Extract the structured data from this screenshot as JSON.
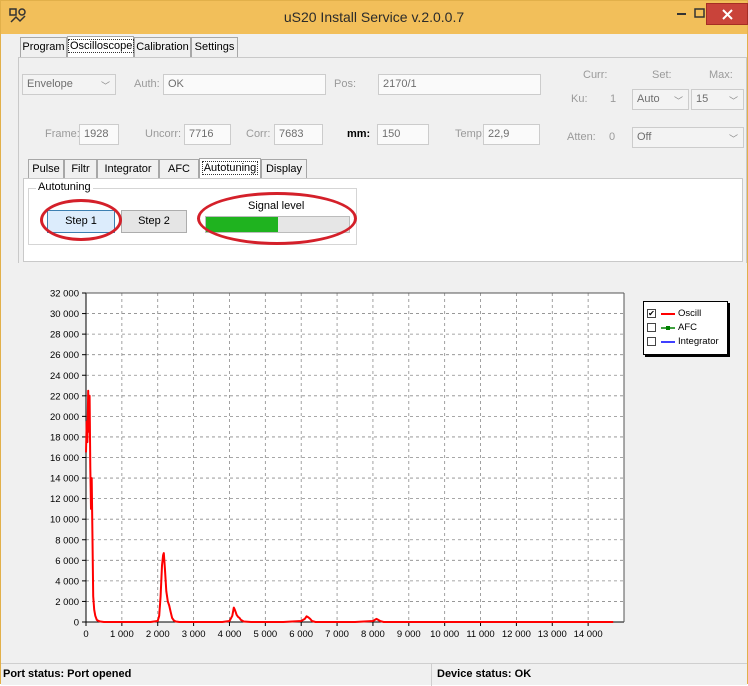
{
  "window": {
    "title": "uS20 Install Service v.2.0.0.7"
  },
  "main_tabs": [
    {
      "label": "Program"
    },
    {
      "label": "Oscilloscope",
      "active": true
    },
    {
      "label": "Calibration"
    },
    {
      "label": "Settings"
    }
  ],
  "params": {
    "mode": "Envelope",
    "auth_label": "Auth:",
    "auth_value": "OK",
    "pos_label": "Pos:",
    "pos_value": "2170/1",
    "frame_label": "Frame:",
    "frame_value": "1928",
    "uncorr_label": "Uncorr:",
    "uncorr_value": "7716",
    "corr_label": "Corr:",
    "corr_value": "7683",
    "mm_label": "mm:",
    "mm_value": "150",
    "temp_label": "Temp:",
    "temp_value": "22,9",
    "curr_header": "Curr:",
    "set_header": "Set:",
    "max_header": "Max:",
    "ku_label": "Ku:",
    "ku_curr": "1",
    "ku_set": "Auto",
    "ku_max": "15",
    "atten_label": "Atten:",
    "atten_curr": "0",
    "atten_set": "Off"
  },
  "sub_tabs": [
    {
      "label": "Pulse"
    },
    {
      "label": "Filtr"
    },
    {
      "label": "Integrator"
    },
    {
      "label": "AFC"
    },
    {
      "label": "Autotuning",
      "active": true
    },
    {
      "label": "Display"
    }
  ],
  "autotuning": {
    "group_label": "Autotuning",
    "step1_label": "Step 1",
    "step2_label": "Step 2",
    "signal_label": "Signal level",
    "signal_level_fraction": 0.5
  },
  "colors": {
    "oscill": "#ff0000",
    "afc": "#008000",
    "integrator": "#0000ff",
    "annotation_ring": "#d4202a",
    "progress": "#1fb31f"
  },
  "legend": [
    {
      "label": "Oscill",
      "checked": true,
      "color": "#ff0000"
    },
    {
      "label": "AFC",
      "checked": false,
      "color": "#008000"
    },
    {
      "label": "Integrator",
      "checked": false,
      "color": "#0000ff"
    }
  ],
  "chart_data": {
    "type": "line",
    "grid": true,
    "legend_position": "top-right",
    "xlim": [
      0,
      15000
    ],
    "ylim": [
      0,
      32000
    ],
    "x_ticks": [
      "0",
      "1 000",
      "2 000",
      "3 000",
      "4 000",
      "5 000",
      "6 000",
      "7 000",
      "8 000",
      "9 000",
      "10 000",
      "11 000",
      "12 000",
      "13 000",
      "14 000"
    ],
    "y_ticks": [
      "0",
      "2 000",
      "4 000",
      "6 000",
      "8 000",
      "10 000",
      "12 000",
      "14 000",
      "16 000",
      "18 000",
      "20 000",
      "22 000",
      "24 000",
      "26 000",
      "28 000",
      "30 000",
      "32 000"
    ],
    "series": [
      {
        "name": "Oscill",
        "x": [
          0,
          20,
          40,
          60,
          80,
          100,
          120,
          140,
          160,
          180,
          200,
          230,
          260,
          300,
          350,
          400,
          500,
          700,
          1000,
          1400,
          1800,
          2000,
          2040,
          2080,
          2120,
          2150,
          2170,
          2200,
          2240,
          2280,
          2320,
          2360,
          2400,
          2450,
          2500,
          2600,
          2800,
          3000,
          3400,
          3800,
          4000,
          4080,
          4120,
          4150,
          4180,
          4200,
          4240,
          4280,
          4320,
          4400,
          4600,
          5000,
          5500,
          6000,
          6100,
          6150,
          6200,
          6250,
          6300,
          6400,
          6600,
          7000,
          7500,
          8000,
          8100,
          8150,
          8200,
          8300,
          8500,
          9000,
          10000,
          11000,
          12000,
          13000,
          14000,
          14700
        ],
        "y": [
          16500,
          19500,
          17500,
          22500,
          18500,
          22000,
          15000,
          11000,
          14000,
          8000,
          2500,
          1200,
          600,
          200,
          100,
          50,
          0,
          0,
          0,
          0,
          0,
          100,
          600,
          2500,
          5500,
          6500,
          6700,
          5200,
          3000,
          2000,
          1600,
          1000,
          400,
          150,
          50,
          0,
          0,
          0,
          0,
          0,
          100,
          600,
          1400,
          1200,
          900,
          700,
          500,
          400,
          200,
          50,
          0,
          0,
          0,
          100,
          300,
          550,
          450,
          300,
          100,
          0,
          0,
          0,
          0,
          100,
          300,
          200,
          100,
          0,
          0,
          0,
          0,
          0,
          0,
          0,
          0,
          0
        ]
      }
    ]
  },
  "status": {
    "port": "Port status: Port opened",
    "device": "Device status: OK"
  }
}
